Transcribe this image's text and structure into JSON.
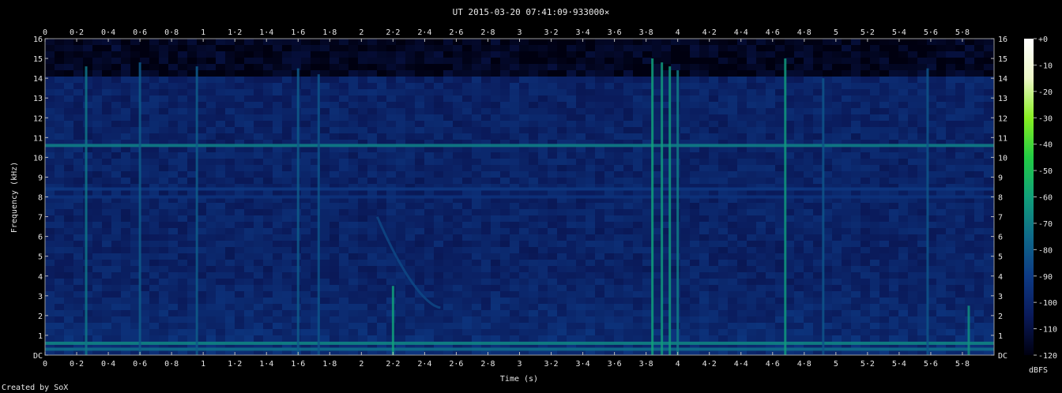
{
  "chart_data": {
    "type": "heatmap",
    "title": "UT 2015-03-20 07:41:09·933000×",
    "xlabel": "Time (s)",
    "ylabel": "Frequency (kHz)",
    "xlim": [
      0,
      6.0
    ],
    "ylim": [
      0,
      16
    ],
    "x_ticks": [
      "0",
      "0·2",
      "0·4",
      "0·6",
      "0·8",
      "1",
      "1·2",
      "1·4",
      "1·6",
      "1·8",
      "2",
      "2·2",
      "2·4",
      "2·6",
      "2·8",
      "3",
      "3·2",
      "3·4",
      "3·6",
      "3·8",
      "4",
      "4·2",
      "4·4",
      "4·6",
      "4·8",
      "5",
      "5·2",
      "5·4",
      "5·6",
      "5·8"
    ],
    "y_ticks": [
      "DC",
      "1",
      "2",
      "3",
      "4",
      "5",
      "6",
      "7",
      "8",
      "9",
      "10",
      "11",
      "12",
      "13",
      "14",
      "15",
      "16"
    ],
    "colorbar": {
      "label": "dBFS",
      "ticks": [
        "+0",
        "-10",
        "-20",
        "-30",
        "-40",
        "-50",
        "-60",
        "-70",
        "-80",
        "-90",
        "-100",
        "-110",
        "-120"
      ],
      "range": [
        -120,
        0
      ],
      "colors": [
        "#000010",
        "#0a1a5a",
        "#0d3a85",
        "#0f6a8a",
        "#11a07a",
        "#22cc44",
        "#88ee22",
        "#eef8c8",
        "#ffffff"
      ]
    },
    "background_dbfs": -100,
    "horizontal_bands": [
      {
        "freq_khz": 10.6,
        "level_dbfs": -70,
        "x_start": 0,
        "x_end": 6.0
      },
      {
        "freq_khz": 8.4,
        "level_dbfs": -92,
        "x_start": 0,
        "x_end": 6.0
      },
      {
        "freq_khz": 8.0,
        "level_dbfs": -94,
        "x_start": 0,
        "x_end": 6.0
      },
      {
        "freq_khz": 0.6,
        "level_dbfs": -68,
        "x_start": 0,
        "x_end": 6.0
      },
      {
        "freq_khz": 0.3,
        "level_dbfs": -75,
        "x_start": 0,
        "x_end": 6.0
      }
    ],
    "vertical_clicks": [
      {
        "time_s": 0.26,
        "f_low": 0.0,
        "f_high": 14.6,
        "level_dbfs": -72
      },
      {
        "time_s": 0.6,
        "f_low": 0.0,
        "f_high": 14.8,
        "level_dbfs": -80
      },
      {
        "time_s": 0.96,
        "f_low": 0.0,
        "f_high": 14.6,
        "level_dbfs": -80
      },
      {
        "time_s": 1.6,
        "f_low": 0.0,
        "f_high": 14.5,
        "level_dbfs": -80
      },
      {
        "time_s": 1.73,
        "f_low": 0.0,
        "f_high": 14.2,
        "level_dbfs": -82
      },
      {
        "time_s": 2.2,
        "f_low": 0.0,
        "f_high": 3.5,
        "level_dbfs": -60
      },
      {
        "time_s": 3.84,
        "f_low": 0.0,
        "f_high": 15.0,
        "level_dbfs": -60
      },
      {
        "time_s": 3.9,
        "f_low": 0.0,
        "f_high": 14.8,
        "level_dbfs": -62
      },
      {
        "time_s": 3.95,
        "f_low": 0.0,
        "f_high": 14.6,
        "level_dbfs": -62
      },
      {
        "time_s": 4.0,
        "f_low": 0.0,
        "f_high": 14.4,
        "level_dbfs": -70
      },
      {
        "time_s": 4.68,
        "f_low": 0.0,
        "f_high": 15.0,
        "level_dbfs": -62
      },
      {
        "time_s": 4.92,
        "f_low": 0.0,
        "f_high": 14.0,
        "level_dbfs": -82
      },
      {
        "time_s": 5.58,
        "f_low": 0.0,
        "f_high": 14.5,
        "level_dbfs": -82
      },
      {
        "time_s": 5.84,
        "f_low": 0.0,
        "f_high": 2.5,
        "level_dbfs": -65
      }
    ],
    "chirp": {
      "t_start": 2.1,
      "f_start": 7.0,
      "t_end": 2.5,
      "f_end": 2.4,
      "level_dbfs": -85
    }
  },
  "footer": "Created by SoX"
}
